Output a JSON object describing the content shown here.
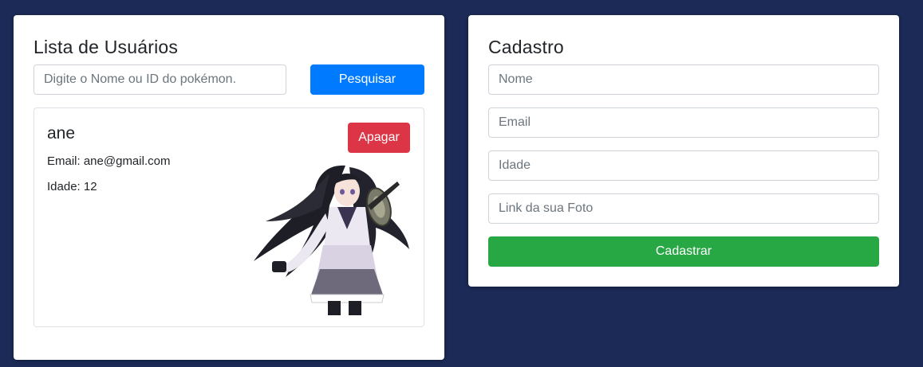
{
  "user_list": {
    "title": "Lista de Usuários",
    "search": {
      "placeholder": "Digite o Nome ou ID do pokémon.",
      "value": "",
      "button_label": "Pesquisar"
    },
    "users": [
      {
        "name": "ane",
        "email_text": "Email: ane@gmail.com",
        "age_text": "Idade: 12",
        "delete_label": "Apagar",
        "photo": "anime-girl-avatar"
      }
    ]
  },
  "register": {
    "title": "Cadastro",
    "fields": {
      "name_placeholder": "Nome",
      "email_placeholder": "Email",
      "age_placeholder": "Idade",
      "photo_placeholder": "Link da sua Foto"
    },
    "button_label": "Cadastrar"
  },
  "colors": {
    "background": "#1b2a56",
    "primary": "#007bff",
    "danger": "#dc3545",
    "success": "#28a745"
  }
}
